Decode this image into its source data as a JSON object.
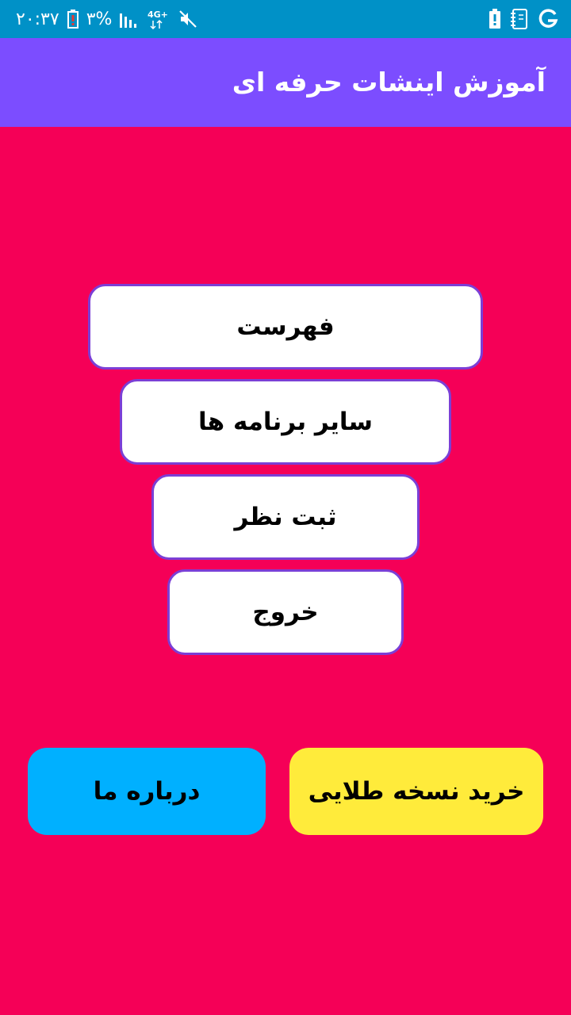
{
  "status_bar": {
    "time": "۲۰:۳۷",
    "battery_percent": "۳%",
    "network_type": "4G+",
    "background_color": "#0091c7",
    "icons": [
      "battery-warning-icon",
      "signal-icon",
      "network-4g-icon",
      "mute-icon",
      "battery-alert-icon",
      "notes-icon",
      "google-icon"
    ]
  },
  "app_bar": {
    "title": "آموزش اینشات حرفه ای",
    "background_color": "#7c4dff"
  },
  "main": {
    "background_color": "#f50057",
    "menu_buttons": [
      {
        "label": "فهرست"
      },
      {
        "label": "سایر برنامه ها"
      },
      {
        "label": "ثبت نظر"
      },
      {
        "label": "خروج"
      }
    ]
  },
  "bottom_buttons": {
    "about": {
      "label": "درباره ما",
      "color": "#00b0ff"
    },
    "gold": {
      "label": "خرید نسخه طلایی",
      "color": "#ffeb3b"
    }
  }
}
